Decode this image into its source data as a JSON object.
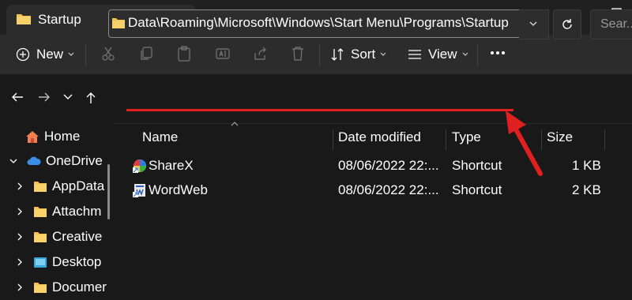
{
  "window": {
    "tab_title": "Startup",
    "new_tab_icon": "plus-icon",
    "controls": [
      "minimize-icon",
      "maximize-icon"
    ]
  },
  "toolbar": {
    "new_label": "New",
    "sort_label": "Sort",
    "view_label": "View",
    "more_icon": "ellipsis-icon",
    "icons": [
      "cut-icon",
      "copy-icon",
      "paste-icon",
      "rename-icon",
      "share-icon",
      "delete-icon"
    ]
  },
  "address": {
    "path_visible": "Data\\Roaming\\Microsoft\\Windows\\Start Menu\\Programs\\Startup",
    "search_placeholder": "Sear..."
  },
  "annotation": {
    "color": "#e02020"
  },
  "sidebar": {
    "items": [
      {
        "label": "Home",
        "icon": "home-icon",
        "indent": 0,
        "chevron": "none"
      },
      {
        "label": "OneDrive",
        "icon": "cloud-icon",
        "indent": 0,
        "chevron": "down"
      },
      {
        "label": "AppData",
        "icon": "folder-icon",
        "indent": 1,
        "chevron": "right"
      },
      {
        "label": "Attachm",
        "icon": "folder-icon",
        "indent": 1,
        "chevron": "right"
      },
      {
        "label": "Creative",
        "icon": "folder-icon",
        "indent": 1,
        "chevron": "right"
      },
      {
        "label": "Desktop",
        "icon": "desktop-icon",
        "indent": 1,
        "chevron": "right"
      },
      {
        "label": "Documer",
        "icon": "folder-icon",
        "indent": 1,
        "chevron": "right"
      }
    ]
  },
  "columns": {
    "name": "Name",
    "date": "Date modified",
    "type": "Type",
    "size": "Size"
  },
  "files": [
    {
      "name": "ShareX",
      "date": "08/06/2022 22:...",
      "type": "Shortcut",
      "size": "1 KB",
      "icon": "sharex-shortcut-icon"
    },
    {
      "name": "WordWeb",
      "date": "08/06/2022 22:...",
      "type": "Shortcut",
      "size": "2 KB",
      "icon": "wordweb-shortcut-icon"
    }
  ]
}
